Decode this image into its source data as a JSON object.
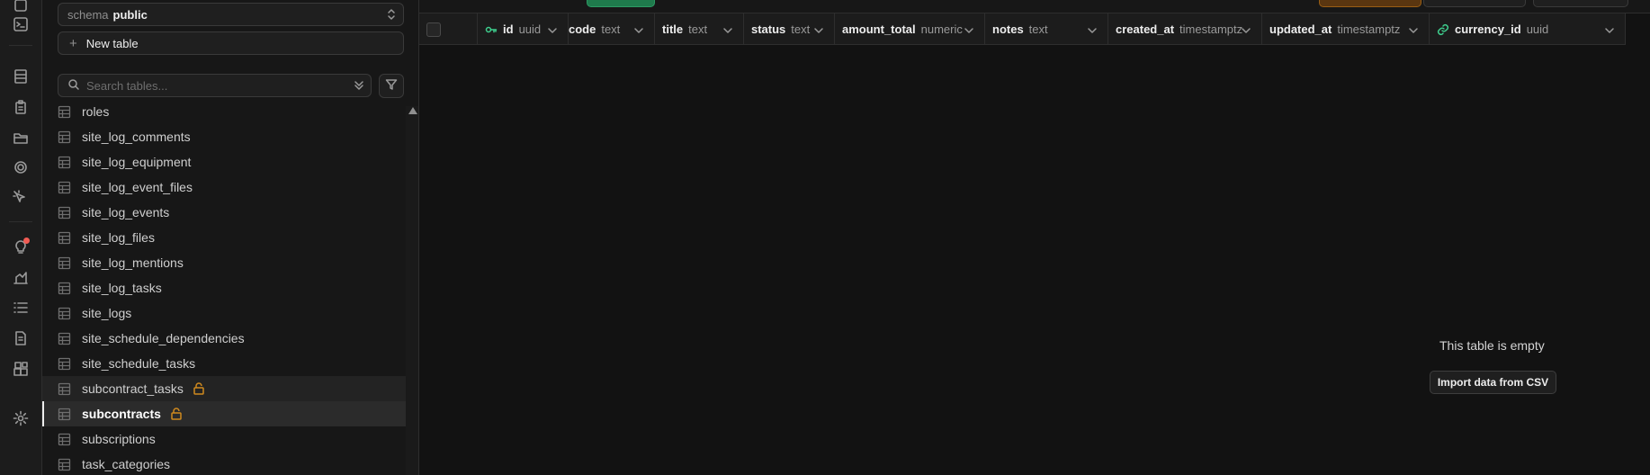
{
  "rail": {
    "icons": [
      "home-icon",
      "terminal-icon",
      "table-editor-icon",
      "sql-editor-icon",
      "storage-icon",
      "realtime-icon",
      "cursor-icon",
      "advisor-icon",
      "reports-icon",
      "logs-icon",
      "api-docs-icon",
      "integrations-icon",
      "settings-icon"
    ]
  },
  "sidebar": {
    "schema_label": "schema",
    "schema_value": "public",
    "new_table_label": "New table",
    "search_placeholder": "Search tables...",
    "tables": [
      {
        "name": "roles",
        "locked": false,
        "state": "normal"
      },
      {
        "name": "site_log_comments",
        "locked": false,
        "state": "normal"
      },
      {
        "name": "site_log_equipment",
        "locked": false,
        "state": "normal"
      },
      {
        "name": "site_log_event_files",
        "locked": false,
        "state": "normal"
      },
      {
        "name": "site_log_events",
        "locked": false,
        "state": "normal"
      },
      {
        "name": "site_log_files",
        "locked": false,
        "state": "normal"
      },
      {
        "name": "site_log_mentions",
        "locked": false,
        "state": "normal"
      },
      {
        "name": "site_log_tasks",
        "locked": false,
        "state": "normal"
      },
      {
        "name": "site_logs",
        "locked": false,
        "state": "normal"
      },
      {
        "name": "site_schedule_dependencies",
        "locked": false,
        "state": "normal"
      },
      {
        "name": "site_schedule_tasks",
        "locked": false,
        "state": "normal"
      },
      {
        "name": "subcontract_tasks",
        "locked": true,
        "state": "hover"
      },
      {
        "name": "subcontracts",
        "locked": true,
        "state": "active"
      },
      {
        "name": "subscriptions",
        "locked": false,
        "state": "normal"
      },
      {
        "name": "task_categories",
        "locked": false,
        "state": "normal"
      }
    ]
  },
  "grid": {
    "columns": [
      {
        "name": "id",
        "type": "uuid",
        "icon": "primary-key-icon"
      },
      {
        "name": "code",
        "type": "text"
      },
      {
        "name": "title",
        "type": "text"
      },
      {
        "name": "status",
        "type": "text"
      },
      {
        "name": "amount_total",
        "type": "numeric"
      },
      {
        "name": "notes",
        "type": "text"
      },
      {
        "name": "created_at",
        "type": "timestamptz"
      },
      {
        "name": "updated_at",
        "type": "timestamptz"
      },
      {
        "name": "currency_id",
        "type": "uuid",
        "icon": "foreign-key-link-icon"
      }
    ],
    "empty_message": "This table is empty",
    "import_button_label": "Import data from CSV"
  },
  "colors": {
    "accent_green": "#1f7a4c",
    "accent_orange": "#7a4a10",
    "lock_orange": "#d08a1e",
    "key_green": "#3ecf8e",
    "notification_red": "#f25c54"
  }
}
